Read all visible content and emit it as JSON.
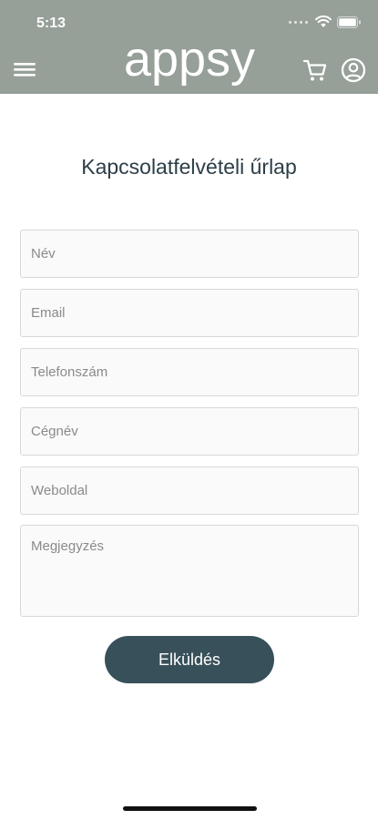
{
  "status_bar": {
    "time": "5:13"
  },
  "header": {
    "logo_text": "appsy",
    "icons": {
      "menu": "menu-icon",
      "cart": "cart-icon",
      "account": "account-icon"
    },
    "colors": {
      "background": "#969f98",
      "foreground": "#ffffff"
    }
  },
  "page": {
    "title": "Kapcsolatfelvételi űrlap"
  },
  "form": {
    "name": {
      "placeholder": "Név",
      "value": ""
    },
    "email": {
      "placeholder": "Email",
      "value": ""
    },
    "phone": {
      "placeholder": "Telefonszám",
      "value": ""
    },
    "company": {
      "placeholder": "Cégnév",
      "value": ""
    },
    "website": {
      "placeholder": "Weboldal",
      "value": ""
    },
    "note": {
      "placeholder": "Megjegyzés",
      "value": ""
    },
    "submit_label": "Elküldés"
  },
  "colors": {
    "title": "#2c3e47",
    "button": "#38505a",
    "field_border": "#d8d8d8",
    "field_background": "#fafafa"
  }
}
